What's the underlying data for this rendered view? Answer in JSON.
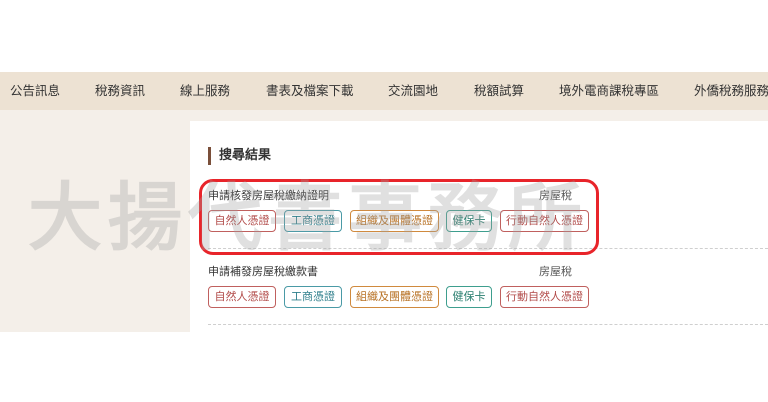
{
  "nav": {
    "items": [
      "公告訊息",
      "稅務資訊",
      "線上服務",
      "書表及檔案下載",
      "交流園地",
      "稅額試算",
      "境外電商課稅專區",
      "外僑稅務服務"
    ]
  },
  "section": {
    "title": "搜尋結果"
  },
  "results": [
    {
      "name": "申請核發房屋稅繳納證明",
      "category": "房屋稅",
      "buttons": [
        "自然人憑證",
        "工商憑證",
        "組織及團體憑證",
        "健保卡",
        "行動自然人憑證"
      ]
    },
    {
      "name": "申請補發房屋稅繳款書",
      "category": "房屋稅",
      "buttons": [
        "自然人憑證",
        "工商憑證",
        "組織及團體憑證",
        "健保卡",
        "行動自然人憑證"
      ]
    }
  ],
  "watermark": "大揚代書事務所",
  "colors": {
    "highlight": "#e8242a",
    "nav_bg": "#ede2d3",
    "accent": "#7a4f3a"
  }
}
